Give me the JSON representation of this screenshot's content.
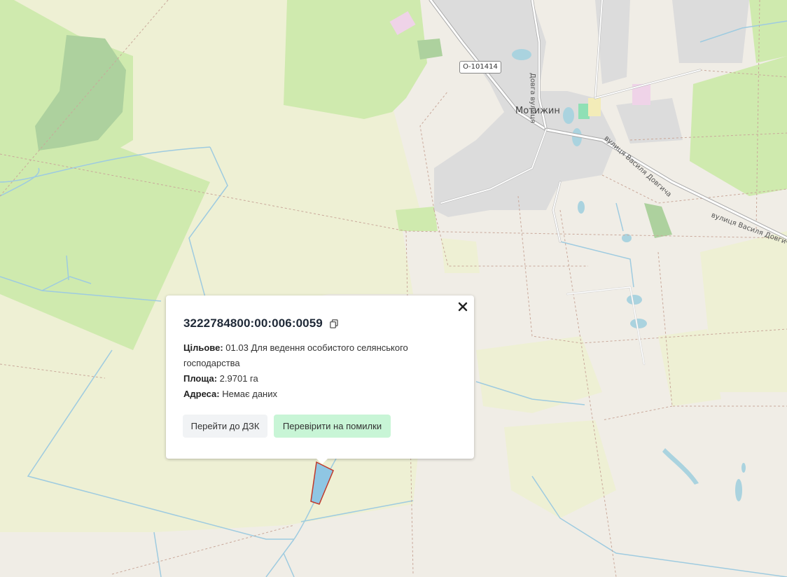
{
  "map": {
    "labels": {
      "town": "Мотижин",
      "road_ref": "О-101414",
      "street_dovha": "Довга вулиця",
      "street_dovhycha_1": "вулиця Василя Довгича",
      "street_dovhycha_2": "вулиця Василя Довгича"
    },
    "colors": {
      "background": "#f0ede6",
      "farmland": "#eef0d4",
      "meadow": "#cfeaae",
      "forest": "#add19e",
      "water": "#aad3df",
      "residential": "#dcdcdc",
      "parcel_fill": "#8fc6e3",
      "parcel_outline": "#c0392b"
    }
  },
  "popup": {
    "cadastral_number": "3222784800:00:006:0059",
    "fields": [
      {
        "label": "Цільове:",
        "value": " 01.03 Для ведення особистого селянського господарства"
      },
      {
        "label": "Площа:",
        "value": " 2.9701 га"
      },
      {
        "label": "Адреса:",
        "value": " Немає даних"
      }
    ],
    "buttons": {
      "dzk": "Перейти до ДЗК",
      "check": "Перевірити на помилки"
    },
    "icons": {
      "copy": "copy-icon",
      "close": "close-icon"
    }
  }
}
